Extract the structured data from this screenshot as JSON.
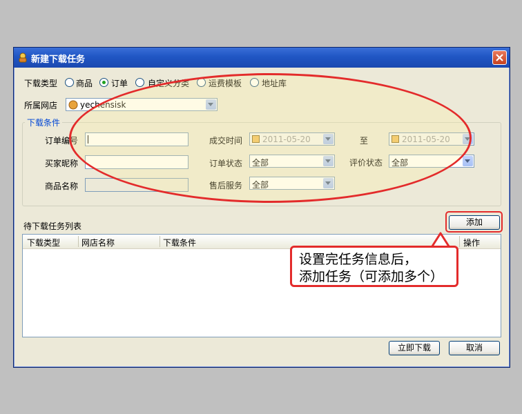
{
  "window": {
    "title": "新建下载任务"
  },
  "download_type": {
    "label": "下载类型",
    "options": [
      "商品",
      "订单",
      "自定义分类",
      "运费模板",
      "地址库"
    ],
    "selected": "订单"
  },
  "shop": {
    "label": "所属网店",
    "value": "yechensisk"
  },
  "conditions": {
    "legend": "下载条件",
    "order_no_label": "订单编号",
    "deal_time_label": "成交时间",
    "deal_time_from": "2011-05-20",
    "to_label": "至",
    "deal_time_to": "2011-05-20",
    "buyer_label": "买家昵称",
    "order_status_label": "订单状态",
    "order_status_value": "全部",
    "rating_status_label": "评价状态",
    "rating_status_value": "全部",
    "product_name_label": "商品名称",
    "after_sale_label": "售后服务",
    "after_sale_value": "全部"
  },
  "task_list": {
    "label": "待下载任务列表",
    "add_button": "添加",
    "columns": [
      "下载类型",
      "网店名称",
      "下载条件",
      "操作"
    ]
  },
  "footer": {
    "download_now": "立即下载",
    "cancel": "取消"
  },
  "annotation": {
    "line1": "设置完任务信息后，",
    "line2": "添加任务（可添加多个）"
  },
  "colors": {
    "annotation_red": "#e32b2b",
    "title_blue": "#2056c4"
  }
}
